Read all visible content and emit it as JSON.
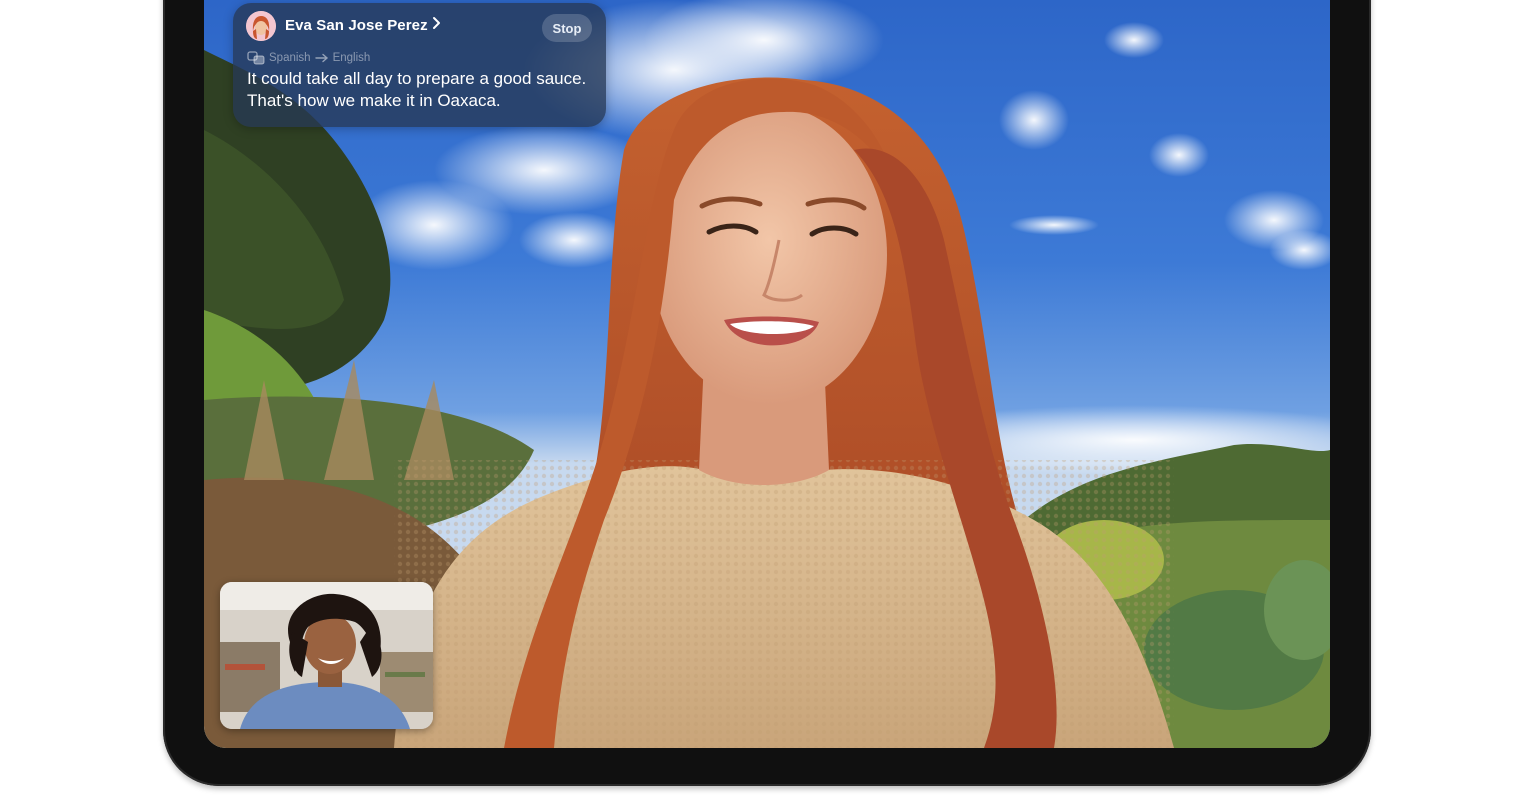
{
  "caption": {
    "speaker_name": "Eva San Jose Perez",
    "stop_label": "Stop",
    "source_language": "Spanish",
    "target_language": "English",
    "translated_text": "It could take all day to prepare a good sauce. That's how we make it in Oaxaca."
  },
  "icons": {
    "speaker_avatar": "memoji-avatar-icon",
    "speaker_chevron": "chevron-right-icon",
    "translate": "translate-icon",
    "language_arrow": "arrow-right-icon"
  },
  "colors": {
    "caption_background": "#263854",
    "sky": "#3f7fd9",
    "hair": "#b5532b",
    "sweater": "#d8b98f",
    "bezel": "#101010"
  }
}
